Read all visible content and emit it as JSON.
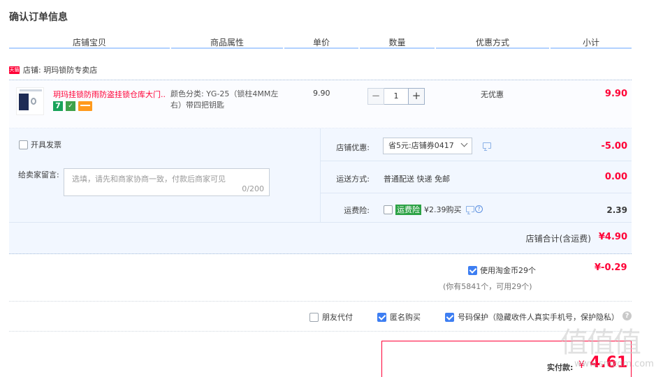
{
  "page_title": "确认订单信息",
  "columns": [
    "店铺宝贝",
    "商品属性",
    "单价",
    "数量",
    "优惠方式",
    "小计"
  ],
  "shop": {
    "badge": "天猫",
    "label": "店铺: 玥玛锁防专卖店"
  },
  "item": {
    "thumbnail_icon": "product-thumbnail",
    "title": "玥玛挂锁防雨防盗挂锁仓库大门...",
    "badge_7": "7",
    "badge_shield": "✓",
    "attribute": "颜色分类: YG-25（锁柱4MM左右）带四把钥匙",
    "unit_price": "9.90",
    "qty_minus": "−",
    "qty": "1",
    "qty_plus": "+",
    "promo": "无优惠",
    "subtotal": "9.90"
  },
  "options": {
    "invoice_label": "开具发票",
    "message_label": "给卖家留言:",
    "message_placeholder": "选填，请先和商家协商一致，付款后商家可见",
    "message_count": "0/200",
    "coupon_label": "店铺优惠:",
    "coupon_value": "省5元:店铺券0417",
    "coupon_amount": "-5.00",
    "shipping_label": "运送方式:",
    "shipping_value": "普通配送 快递 免邮",
    "shipping_amount": "0.00",
    "insurance_label": "运费险:",
    "insurance_tag": "运费险",
    "insurance_price": "¥2.39购买",
    "insurance_amount": "2.39",
    "shop_total_label": "店铺合计(含运费)",
    "shop_total_value": "¥4.90"
  },
  "coins": {
    "label": "使用淘金币29个",
    "value": "¥-0.29",
    "note": "(你有5841个，可用29个)"
  },
  "extras": {
    "friend_pay": "朋友代付",
    "anonymous": "匿名购买",
    "number_protect": "号码保护（隐藏收件人真实手机号，保护隐私）",
    "help": "?"
  },
  "payment": {
    "label": "实付款:",
    "currency": "¥",
    "value": "4.61"
  },
  "watermark": {
    "logo": "值值值",
    "url": "www.smzdm.com"
  },
  "colors": {
    "accent_red": "#ff0036",
    "checkbox_blue": "#3d7ef2",
    "panel_bg": "#f2f7ff",
    "header_line": "#b2d1ff"
  }
}
